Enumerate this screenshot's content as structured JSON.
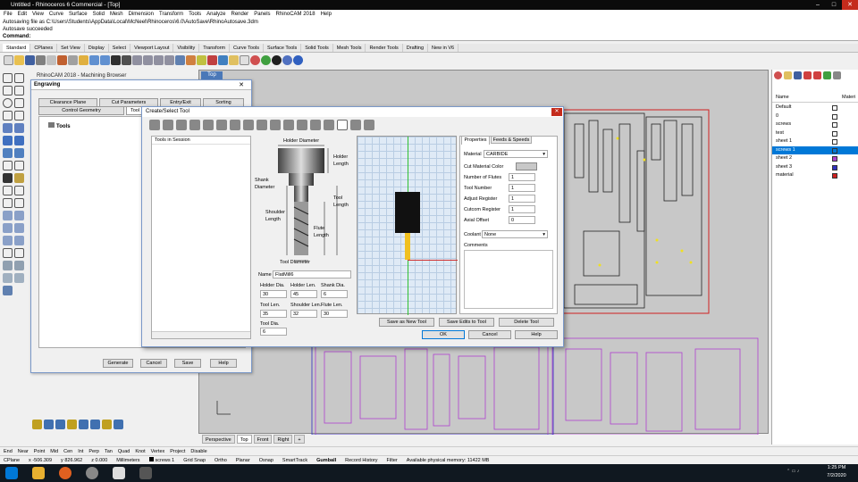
{
  "titlebar": {
    "title": "Untitled - Rhinoceros 6 Commercial - [Top]",
    "minimize": "–",
    "maximize": "□",
    "close": "✕"
  },
  "menu": [
    "File",
    "Edit",
    "View",
    "Curve",
    "Surface",
    "Solid",
    "Mesh",
    "Dimension",
    "Transform",
    "Tools",
    "Analyze",
    "Render",
    "Panels",
    "RhinoCAM 2018",
    "Help"
  ],
  "command_history": [
    "Autosaving file as C:\\Users\\Students\\AppData\\Local\\McNeel\\Rhinoceros\\6.0\\AutoSave\\RhinoAutosave.3dm",
    "Autosave succeeded"
  ],
  "command_label": "Command:",
  "toolbar_tabs": [
    "Standard",
    "CPlanes",
    "Set View",
    "Display",
    "Select",
    "Viewport Layout",
    "Visibility",
    "Transform",
    "Curve Tools",
    "Surface Tools",
    "Solid Tools",
    "Mesh Tools",
    "Render Tools",
    "Drafting",
    "New in V6"
  ],
  "machining_browser": {
    "title": "RhinoCAM 2018 - Machining Browser",
    "view_title": "Top",
    "engraving_title": "Engraving",
    "tabs_row1": [
      "Clearance Plane",
      "Cut Parameters",
      "Entry/Exit",
      "Sorting"
    ],
    "tabs_row2": [
      "Control Geometry",
      "Tool"
    ],
    "tree_root": "Tools",
    "buttons": [
      "Generate",
      "Cancel",
      "Save",
      "Help"
    ]
  },
  "dialog": {
    "title": "Create/Select Tool",
    "close": "✕",
    "list_header": "Tools in Session",
    "diagram_labels": {
      "holder_diameter": "Holder Diameter",
      "holder_length": "Holder Length",
      "shank_diameter": "Shank Diameter",
      "tool_length": "Tool Length",
      "shoulder_length": "Shoulder Length",
      "flute_length": "Flute Length",
      "tool_diameter": "Tool Diameter"
    },
    "name_label": "Name",
    "name_value": "FlatMill6",
    "fields": {
      "holder_dia": {
        "label": "Holder Dia.",
        "value": "30"
      },
      "holder_len": {
        "label": "Holder Len.",
        "value": "45"
      },
      "shank_dia": {
        "label": "Shank Dia.",
        "value": "6"
      },
      "tool_len": {
        "label": "Tool Len.",
        "value": "35"
      },
      "shoulder_len": {
        "label": "Shoulder Len.",
        "value": "32"
      },
      "flute_len": {
        "label": "Flute Len.",
        "value": "30"
      },
      "tool_dia": {
        "label": "Tool Dia.",
        "value": "6"
      }
    },
    "tabs": [
      "Properties",
      "Feeds & Speeds"
    ],
    "properties": {
      "material_label": "Material",
      "material_value": "CARBIDE",
      "cut_color_label": "Cut Material Color",
      "rows": [
        {
          "label": "Number of Flutes",
          "value": "1"
        },
        {
          "label": "Tool Number",
          "value": "1"
        },
        {
          "label": "Adjust Register",
          "value": "1"
        },
        {
          "label": "Cutcom Register",
          "value": "1"
        },
        {
          "label": "Axial Offset",
          "value": "0"
        }
      ],
      "coolant_label": "Coolant",
      "coolant_value": "None",
      "comments_label": "Comments"
    },
    "buttons": {
      "save_new": "Save as New Tool",
      "save_edits": "Save Edits to Tool",
      "delete": "Delete Tool",
      "ok": "OK",
      "cancel": "Cancel",
      "help": "Help"
    }
  },
  "layers": {
    "header": "Name",
    "header2": "Materi",
    "rows": [
      {
        "name": "Default",
        "color": "#000000"
      },
      {
        "name": "0",
        "color": "#ffffff"
      },
      {
        "name": "screws",
        "color": "#000000"
      },
      {
        "name": "test",
        "color": "#000000"
      },
      {
        "name": "sheet 1",
        "color": "#000000"
      },
      {
        "name": "screws 1",
        "color": "#000000",
        "selected": true
      },
      {
        "name": "sheet 2",
        "color": "#b040d0"
      },
      {
        "name": "sheet 3",
        "color": "#3030c0"
      },
      {
        "name": "material",
        "color": "#d02020"
      }
    ]
  },
  "view_tabs": [
    "Perspective",
    "Top",
    "Front",
    "Right",
    "+"
  ],
  "osnaps": [
    "End",
    "Near",
    "Point",
    "Mid",
    "Cen",
    "Int",
    "Perp",
    "Tan",
    "Quad",
    "Knot",
    "Vertex",
    "Project",
    "Disable"
  ],
  "status": {
    "cplane": "CPlane",
    "x": "x -506.309",
    "y": "y 826.962",
    "z": "z 0.000",
    "units": "Millimeters",
    "layer": "screws 1",
    "toggles": [
      "Grid Snap",
      "Ortho",
      "Planar",
      "Osnap",
      "SmartTrack",
      "Gumball",
      "Record History",
      "Filter"
    ],
    "memory": "Available physical memory: 11422 MB"
  },
  "taskbar": {
    "time": "1:25 PM",
    "date": "7/2/2020"
  },
  "colors": {
    "accent": "#0078d7",
    "tool_holder": "#111111",
    "tool_flute": "#f0c020",
    "sheet_purple": "#b040d0",
    "material_red": "#d02020"
  }
}
